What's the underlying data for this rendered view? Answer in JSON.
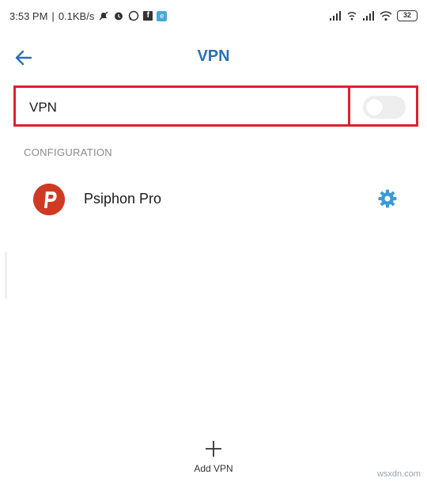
{
  "status_bar": {
    "time": "3:53 PM",
    "speed": "0.1KB/s",
    "battery": "32"
  },
  "header": {
    "title": "VPN"
  },
  "vpn_toggle": {
    "label": "VPN",
    "enabled": false
  },
  "configuration": {
    "section_title": "CONFIGURATION",
    "profiles": [
      {
        "name": "Psiphon Pro"
      }
    ]
  },
  "actions": {
    "add_label": "Add VPN"
  },
  "watermark": "wsxdn.com",
  "colors": {
    "title": "#2d6fb3",
    "accent": "#3a9ad9",
    "highlight": "#d92231",
    "logo": "#cf3a24"
  }
}
